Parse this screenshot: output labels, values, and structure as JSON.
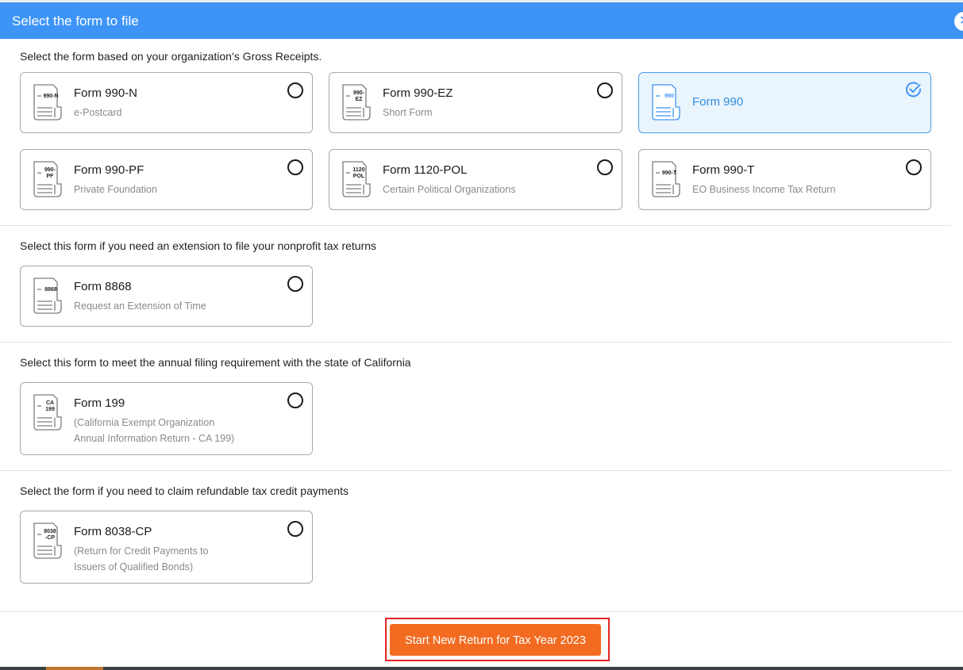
{
  "header": {
    "title": "Select the form to file",
    "close_icon": "close-icon"
  },
  "sections": [
    {
      "label": "Select the form based on your organization’s Gross Receipts."
    },
    {
      "label": "Select this form if you need an extension to file your nonprofit tax returns"
    },
    {
      "label": "Select this form to meet the annual filing requirement with the state of California"
    },
    {
      "label": "Select the form if you need to claim refundable tax credit payments"
    }
  ],
  "forms": [
    {
      "id": "990n",
      "code": [
        "990-N"
      ],
      "title": "Form 990-N",
      "subtitle": [
        "e-Postcard"
      ],
      "selected": false
    },
    {
      "id": "990ez",
      "code": [
        "990-",
        "EZ"
      ],
      "title": "Form 990-EZ",
      "subtitle": [
        "Short Form"
      ],
      "selected": false
    },
    {
      "id": "990",
      "code": [
        "990"
      ],
      "title": "Form 990",
      "subtitle": [],
      "selected": true
    },
    {
      "id": "990pf",
      "code": [
        "990-",
        "PF"
      ],
      "title": "Form 990-PF",
      "subtitle": [
        "Private Foundation"
      ],
      "selected": false
    },
    {
      "id": "1120pol",
      "code": [
        "1120",
        "POL"
      ],
      "title": "Form 1120-POL",
      "subtitle": [
        "Certain Political Organizations"
      ],
      "selected": false
    },
    {
      "id": "990t",
      "code": [
        "990-T"
      ],
      "title": "Form 990-T",
      "subtitle": [
        "EO Business Income Tax Return"
      ],
      "selected": false
    },
    {
      "id": "8868",
      "code": [
        "8868"
      ],
      "title": "Form 8868",
      "subtitle": [
        "Request an Extension of Time"
      ],
      "selected": false
    },
    {
      "id": "199",
      "code": [
        "CA",
        "199"
      ],
      "title": "Form 199",
      "subtitle": [
        "(California Exempt Organization",
        "Annual Information Return - CA 199)"
      ],
      "selected": false
    },
    {
      "id": "8038cp",
      "code": [
        "8038",
        "-CP"
      ],
      "title": "Form 8038-CP",
      "subtitle": [
        "(Return for Credit Payments to",
        "Issuers of Qualified Bonds)"
      ],
      "selected": false
    }
  ],
  "colors": {
    "accent": "#3d94f6",
    "selected": "#2f8de0",
    "cta": "#f26b21",
    "highlight": "#e02424"
  },
  "icons": {
    "form": "document-icon",
    "selected": "check-circle-icon",
    "unselected": "radio-icon"
  },
  "footer": {
    "cta_label": "Start New Return for Tax Year 2023"
  }
}
